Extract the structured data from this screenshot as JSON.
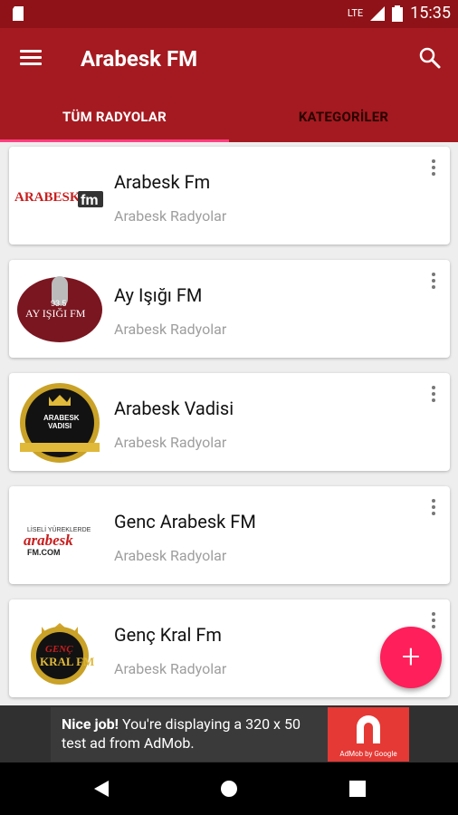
{
  "status_bar": {
    "time": "15:35",
    "network": "LTE"
  },
  "app_bar": {
    "title": "Arabesk FM"
  },
  "tabs": [
    {
      "label": "TÜM RADYOLAR"
    },
    {
      "label": "KATEGORİLER"
    }
  ],
  "stations": [
    {
      "name": "Arabesk Fm",
      "category": "Arabesk Radyolar"
    },
    {
      "name": "Ay Işığı FM",
      "category": "Arabesk Radyolar"
    },
    {
      "name": "Arabesk  Vadisi",
      "category": "Arabesk Radyolar"
    },
    {
      "name": "Genc Arabesk FM",
      "category": "Arabesk Radyolar"
    },
    {
      "name": "Genç Kral Fm",
      "category": "Arabesk Radyolar"
    }
  ],
  "fab": {
    "label": "+"
  },
  "ad": {
    "bold": "Nice job!",
    "text": " You're displaying a 320 x 50 test ad from AdMob.",
    "brand": "AdMob by Google"
  },
  "colors": {
    "primary": "#a51a20",
    "status": "#8e1217",
    "accent": "#ff1f5a"
  }
}
